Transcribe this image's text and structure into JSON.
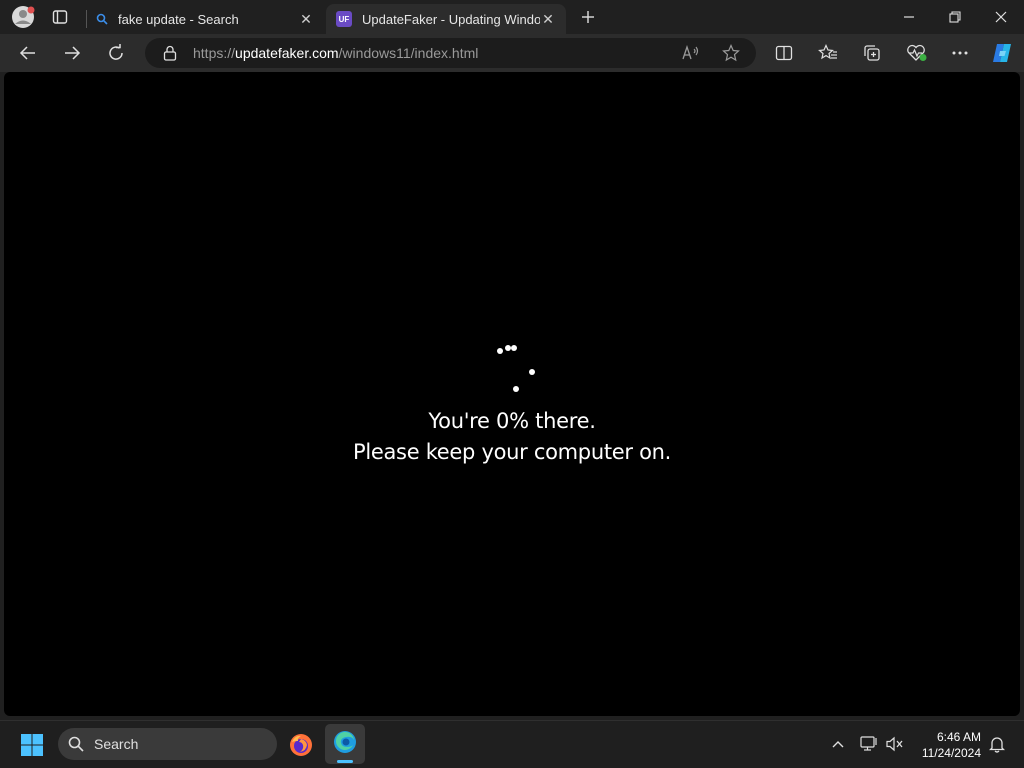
{
  "browser": {
    "tabs": [
      {
        "title": "fake update - Search",
        "icon": "search-icon"
      },
      {
        "title": "UpdateFaker - Updating Windows",
        "icon": "uf-logo-icon",
        "logo_text": "UF",
        "active": true
      }
    ],
    "address": {
      "prefix": "https://",
      "domain": "updatefaker.com",
      "path": "/windows11/index.html"
    }
  },
  "page": {
    "progress_line": "You're  0% there.",
    "keep_on_line": "Please keep your computer on.",
    "progress_percent": 0
  },
  "taskbar": {
    "search_label": "Search",
    "time": "6:46 AM",
    "date": "11/24/2024"
  },
  "colors": {
    "background": "#000000",
    "chrome": "#202020",
    "toolbar": "#2c2c2c",
    "uf_logo": "#6a4bc4",
    "search_tab_icon": "#3b8eea"
  }
}
